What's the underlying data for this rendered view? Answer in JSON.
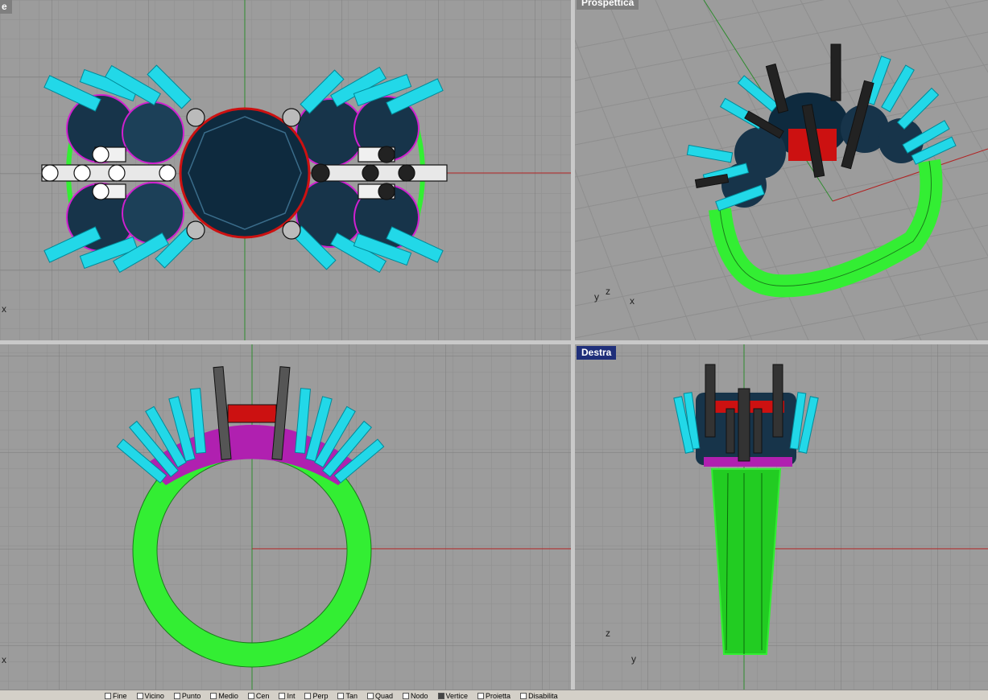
{
  "viewports": {
    "top": {
      "title": "e"
    },
    "perspective": {
      "title": "Prospettica"
    },
    "front": {
      "title": ""
    },
    "right": {
      "title": "Destra"
    }
  },
  "axis_labels": {
    "top_x": "x",
    "persp_y": "y",
    "persp_z": "z",
    "persp_x": "x",
    "front_x": "x",
    "right_z": "z",
    "right_y": "y"
  },
  "osnaps": [
    {
      "label": "Fine",
      "checked": false
    },
    {
      "label": "Vicino",
      "checked": false
    },
    {
      "label": "Punto",
      "checked": false
    },
    {
      "label": "Medio",
      "checked": false
    },
    {
      "label": "Cen",
      "checked": false
    },
    {
      "label": "Int",
      "checked": false
    },
    {
      "label": "Perp",
      "checked": false
    },
    {
      "label": "Tan",
      "checked": false
    },
    {
      "label": "Quad",
      "checked": false
    },
    {
      "label": "Nodo",
      "checked": false
    },
    {
      "label": "Vertice",
      "checked": true
    },
    {
      "label": "Proietta",
      "checked": false
    },
    {
      "label": "Disabilita",
      "checked": false
    }
  ],
  "colors": {
    "viewport_bg": "#9c9c9c",
    "grid_minor": "#8e8e8e",
    "grid_major": "#7a7a7a",
    "x_axis": "#b22222",
    "y_axis": "#2e8b2e",
    "shank": "#33ee33",
    "prong_cyan": "#22d8e8",
    "prong_black": "#1a1a1a",
    "gem": "#0e2a3e",
    "gallery_red": "#cc1111",
    "magenta": "#d020d0",
    "active_title_bg": "#1f2f7a"
  }
}
